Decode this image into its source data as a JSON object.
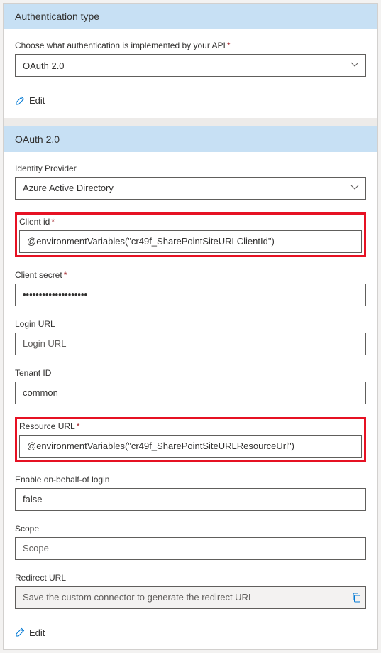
{
  "authSection": {
    "header": "Authentication type",
    "prompt": "Choose what authentication is implemented by your API",
    "selected": "OAuth 2.0",
    "editLabel": "Edit"
  },
  "oauthSection": {
    "header": "OAuth 2.0",
    "identityProvider": {
      "label": "Identity Provider",
      "value": "Azure Active Directory"
    },
    "clientId": {
      "label": "Client id",
      "value": "@environmentVariables(\"cr49f_SharePointSiteURLClientId\")"
    },
    "clientSecret": {
      "label": "Client secret",
      "value": "••••••••••••••••••••"
    },
    "loginUrl": {
      "label": "Login URL",
      "value": "",
      "placeholder": "Login URL"
    },
    "tenantId": {
      "label": "Tenant ID",
      "value": "common"
    },
    "resourceUrl": {
      "label": "Resource URL",
      "value": "@environmentVariables(\"cr49f_SharePointSiteURLResourceUrl\")"
    },
    "enableObo": {
      "label": "Enable on-behalf-of login",
      "value": "false"
    },
    "scope": {
      "label": "Scope",
      "value": "",
      "placeholder": "Scope"
    },
    "redirectUrl": {
      "label": "Redirect URL",
      "placeholder": "Save the custom connector to generate the redirect URL"
    },
    "editLabel": "Edit"
  }
}
